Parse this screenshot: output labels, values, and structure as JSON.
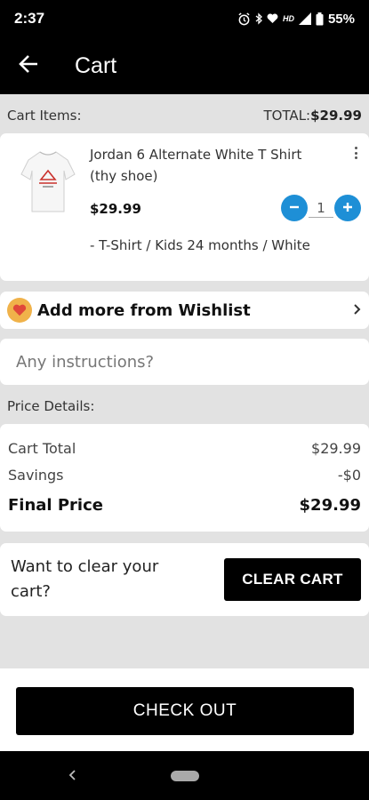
{
  "status_bar": {
    "time": "2:37",
    "hd": "HD",
    "battery": "55%"
  },
  "app_bar": {
    "title": "Cart"
  },
  "cart_header": {
    "label": "Cart Items:",
    "total_label": "TOTAL:",
    "total_value": "$29.99"
  },
  "item": {
    "name": "Jordan 6 Alternate White T Shirt (thy shoe)",
    "price": "$29.99",
    "quantity": "1",
    "variant": "- T-Shirt / Kids 24 months / White"
  },
  "wishlist": {
    "label": "Add more from Wishlist"
  },
  "instructions": {
    "placeholder": "Any instructions?"
  },
  "price_details": {
    "label": "Price Details:",
    "rows": [
      {
        "label": "Cart Total",
        "value": "$29.99"
      },
      {
        "label": "Savings",
        "value": "-$0"
      }
    ],
    "final_label": "Final Price",
    "final_value": "$29.99"
  },
  "clear": {
    "text": "Want to clear your cart?",
    "button": "CLEAR CART"
  },
  "checkout": {
    "button": "CHECK OUT"
  },
  "colors": {
    "accent": "#1e8fd6",
    "heart_bg": "#f0b24a",
    "heart": "#e0483a"
  }
}
